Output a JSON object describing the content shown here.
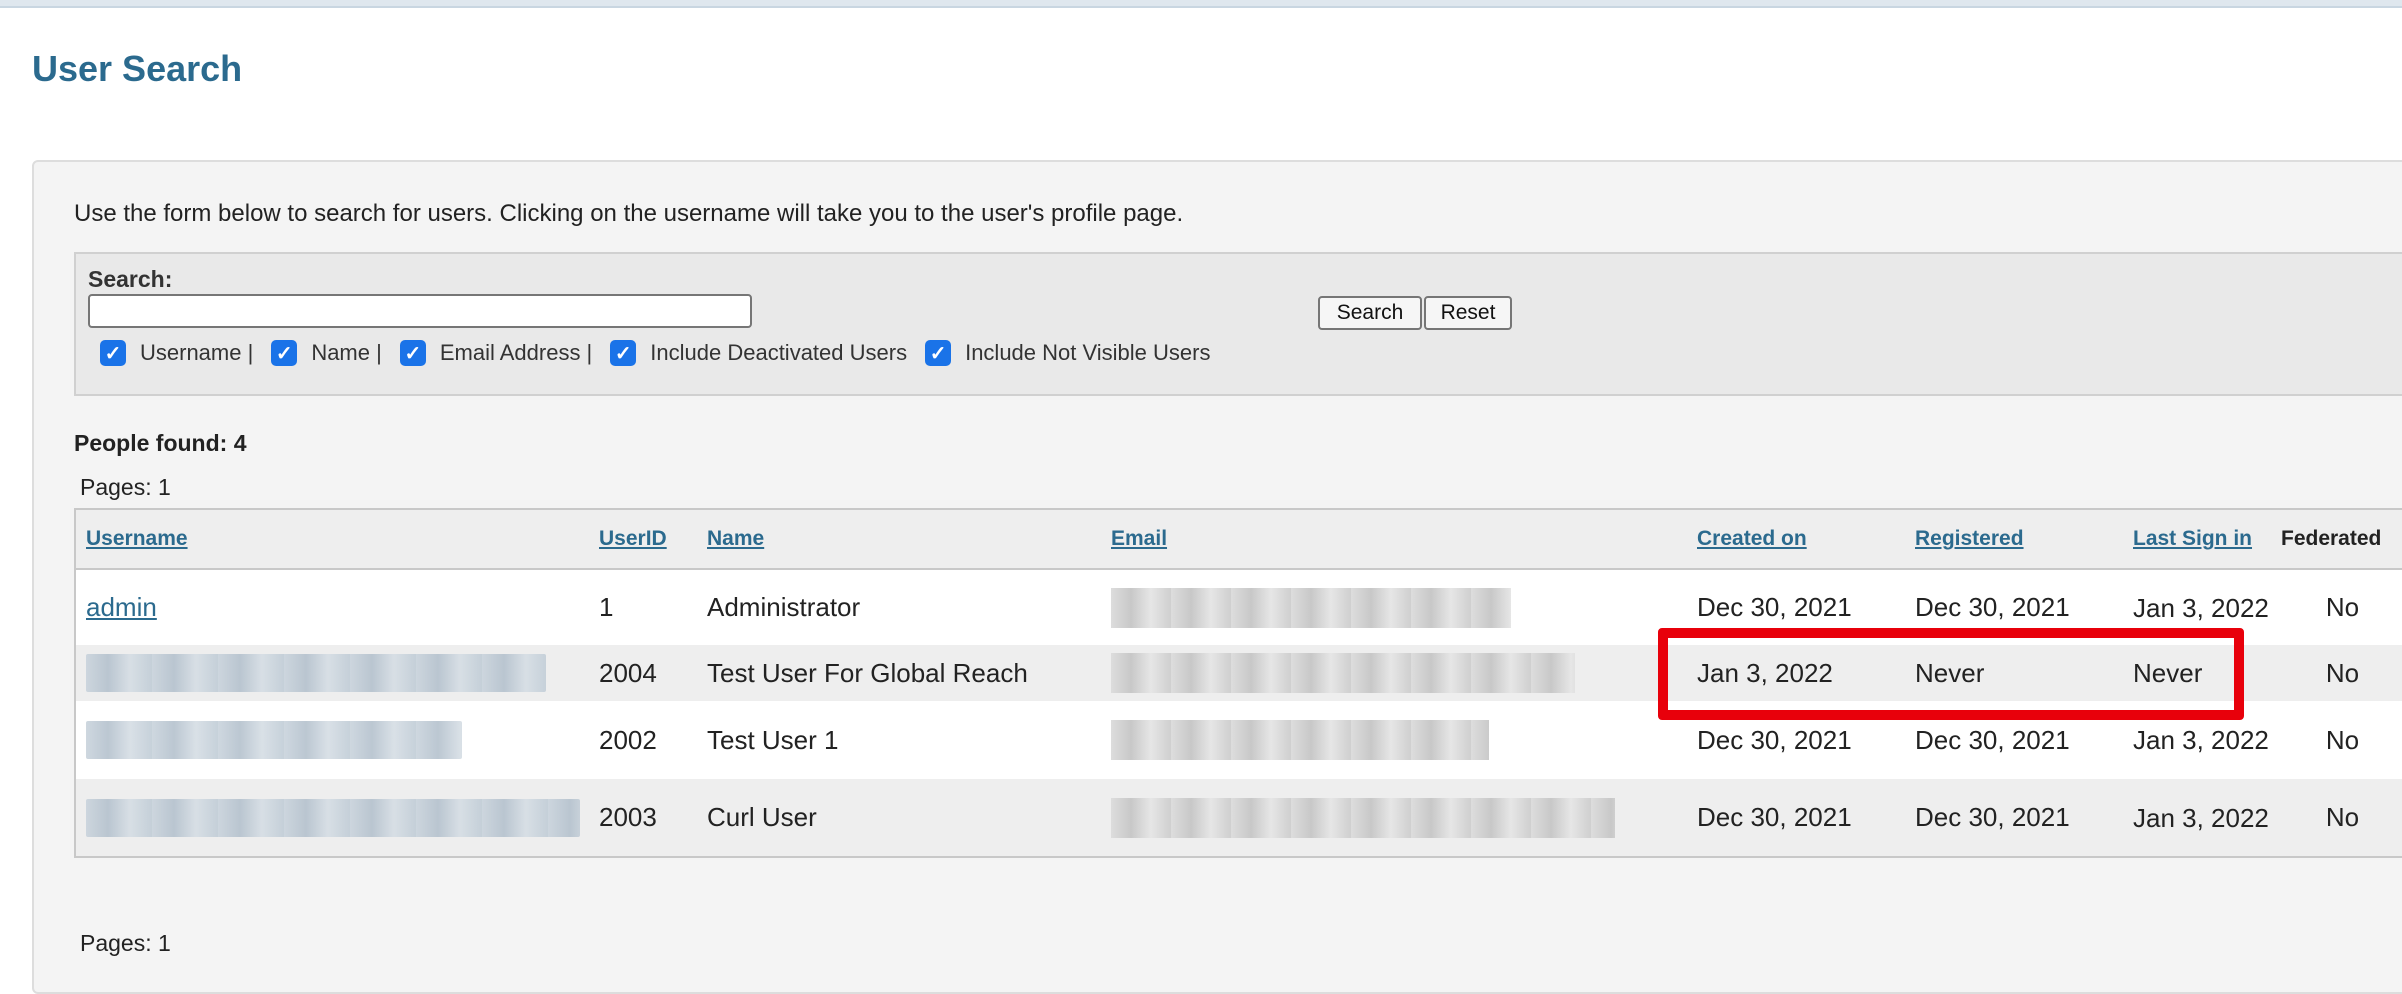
{
  "page": {
    "title": "User Search",
    "intro": "Use the form below to search for users. Clicking on the username will take you to the user's profile page."
  },
  "search": {
    "label": "Search:",
    "value": "",
    "search_button": "Search",
    "reset_button": "Reset",
    "options": [
      {
        "label": "Username |",
        "checked": true
      },
      {
        "label": "Name |",
        "checked": true
      },
      {
        "label": "Email Address |",
        "checked": true
      },
      {
        "label": "Include Deactivated Users",
        "checked": true
      },
      {
        "label": "Include Not Visible Users",
        "checked": true
      }
    ]
  },
  "results": {
    "found": "People found: 4",
    "pages_top": "Pages: 1",
    "pages_bottom": "Pages: 1",
    "columns": [
      "Username",
      "UserID",
      "Name",
      "Email",
      "Created on",
      "Registered",
      "Last Sign in",
      "Federated"
    ],
    "rows": [
      {
        "username": "admin",
        "userid": "1",
        "name": "Administrator",
        "created": "Dec 30, 2021",
        "registered": "Dec 30, 2021",
        "last_sign_in": "Jan 3, 2022",
        "federated": "No"
      },
      {
        "username": "",
        "userid": "2004",
        "name": "Test User For Global Reach",
        "created": "Jan 3, 2022",
        "registered": "Never",
        "last_sign_in": "Never",
        "federated": "No"
      },
      {
        "username": "",
        "userid": "2002",
        "name": "Test User 1",
        "created": "Dec 30, 2021",
        "registered": "Dec 30, 2021",
        "last_sign_in": "Jan 3, 2022",
        "federated": "No"
      },
      {
        "username": "",
        "userid": "2003",
        "name": "Curl User",
        "created": "Dec 30, 2021",
        "registered": "Dec 30, 2021",
        "last_sign_in": "Jan 3, 2022",
        "federated": "No"
      }
    ]
  },
  "colors": {
    "title": "#2b6a8e",
    "link": "#2b6a8e",
    "highlight": "#e8000b",
    "checkbox": "#1a73e8"
  },
  "icons": [
    "checkbox-checked-icon"
  ]
}
